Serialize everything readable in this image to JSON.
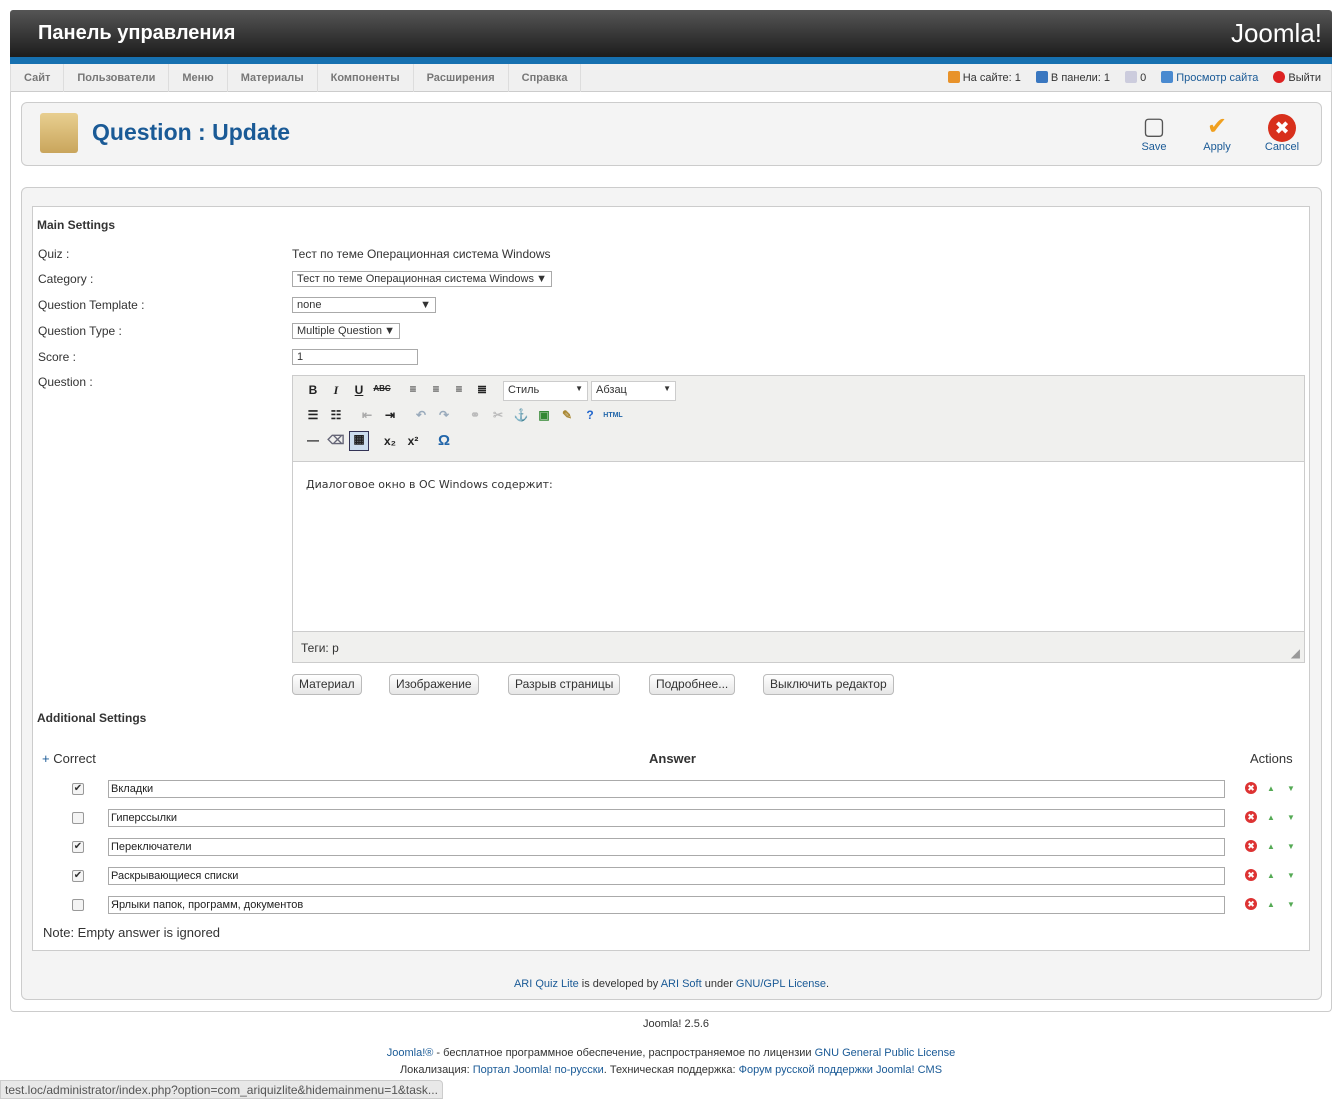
{
  "header": {
    "title": "Панель управления",
    "logo": "Joomla!"
  },
  "menu": [
    "Сайт",
    "Пользователи",
    "Меню",
    "Материалы",
    "Компоненты",
    "Расширения",
    "Справка"
  ],
  "status": {
    "on_site": "На сайте: 1",
    "in_panel": "В панели: 1",
    "messages": "0",
    "view_site": "Просмотр сайта",
    "logout": "Выйти"
  },
  "toolbar": {
    "title": "Question : Update",
    "save": "Save",
    "apply": "Apply",
    "cancel": "Cancel"
  },
  "form": {
    "main_settings": "Main Settings",
    "quiz_label": "Quiz :",
    "quiz_value": "Тест по теме Операционная система Windows",
    "category_label": "Category :",
    "category_value": "Тест по теме Операционная система Windows",
    "template_label": "Question Template :",
    "template_value": "none",
    "type_label": "Question Type :",
    "type_value": "Multiple Question",
    "score_label": "Score :",
    "score_value": "1",
    "question_label": "Question :"
  },
  "editor": {
    "style": "Стиль",
    "format": "Абзац",
    "content": "Диалоговое окно в ОС Windows содержит:",
    "path": "Теги: p",
    "buttons": [
      "Материал",
      "Изображение",
      "Разрыв страницы",
      "Подробнее...",
      "Выключить редактор"
    ]
  },
  "answers": {
    "section": "Additional Settings",
    "col_correct": "Correct",
    "col_answer": "Answer",
    "col_actions": "Actions",
    "rows": [
      {
        "text": "Вкладки",
        "correct": true
      },
      {
        "text": "Гиперссылки",
        "correct": false
      },
      {
        "text": "Переключатели",
        "correct": true
      },
      {
        "text": "Раскрывающиеся списки",
        "correct": true
      },
      {
        "text": "Ярлыки папок, программ, документов",
        "correct": false
      }
    ],
    "note": "Note: Empty answer is ignored"
  },
  "credits": {
    "ari_quiz": "ARI Quiz Lite",
    "dev_by": " is developed by ",
    "ari_soft": "ARI Soft",
    "under": " under ",
    "license": "GNU/GPL License",
    "dot": "."
  },
  "footer": {
    "version": "Joomla! 2.5.6",
    "joomla": "Joomla!®",
    "free": " - бесплатное программное обеспечение, распространяемое по лицензии ",
    "gpl": "GNU General Public License",
    "loc": "Локализация: ",
    "portal": "Портал Joomla! по-русски",
    "support": ". Техническая поддержка: ",
    "forum": "Форум русской поддержки Joomla! CMS"
  },
  "statusbar": "test.loc/administrator/index.php?option=com_ariquizlite&hidemainmenu=1&task..."
}
